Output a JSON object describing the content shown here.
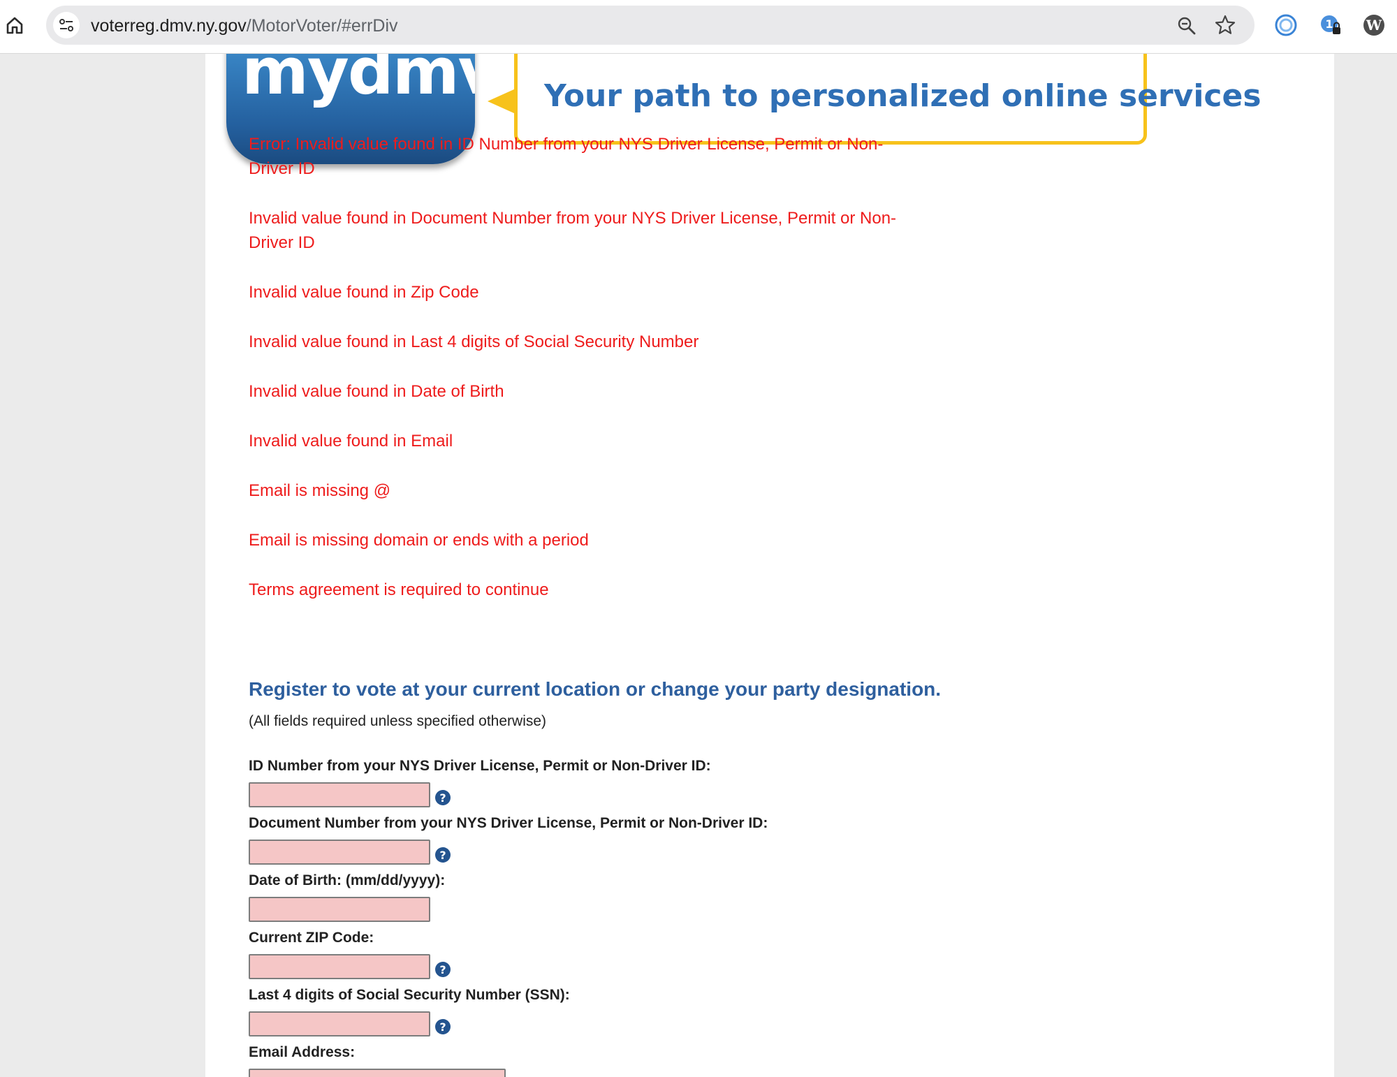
{
  "browser": {
    "url_host": "voterreg.dmv.ny.gov",
    "url_path": "/MotorVoter/#errDiv",
    "icons": [
      "home-icon",
      "site-settings-icon",
      "zoom-icon",
      "bookmark-star-icon",
      "extension-circle-icon",
      "extension-password-icon",
      "extension-wordpress-icon"
    ]
  },
  "header": {
    "logo_text": "mydmv",
    "logo_dot": ".",
    "tagline": "Your path to personalized online services"
  },
  "errors": [
    "Error: Invalid value found in ID Number from your NYS Driver License, Permit or Non-Driver ID",
    "Invalid value found in Document Number from your NYS Driver License, Permit or Non-Driver ID",
    "Invalid value found in Zip Code",
    "Invalid value found in Last 4 digits of Social Security Number",
    "Invalid value found in Date of Birth",
    "Invalid value found in Email",
    "Email is missing @",
    "Email is missing domain or ends with a period",
    "Terms agreement is required to continue"
  ],
  "form": {
    "title": "Register to vote at your current location or change your party designation.",
    "note": "(All fields required unless specified otherwise)",
    "fields": [
      {
        "label": "ID Number from your NYS Driver License, Permit or Non-Driver ID:",
        "value": "",
        "help": true
      },
      {
        "label": "Document Number from your NYS Driver License, Permit or Non-Driver ID:",
        "value": "",
        "help": true
      },
      {
        "label": "Date of Birth: (mm/dd/yyyy):",
        "value": "",
        "help": false
      },
      {
        "label": "Current ZIP Code:",
        "value": "",
        "help": true
      },
      {
        "label": "Last 4 digits of Social Security Number (SSN):",
        "value": "",
        "help": true
      },
      {
        "label": "Email Address:",
        "value": "",
        "help": false
      }
    ]
  },
  "colors": {
    "error": "#ee1c1c",
    "title": "#2e5f9e",
    "invalid_field_bg": "#f5c6c6",
    "tagline": "#2f6fb5",
    "logo_accent": "#f7c21b"
  }
}
